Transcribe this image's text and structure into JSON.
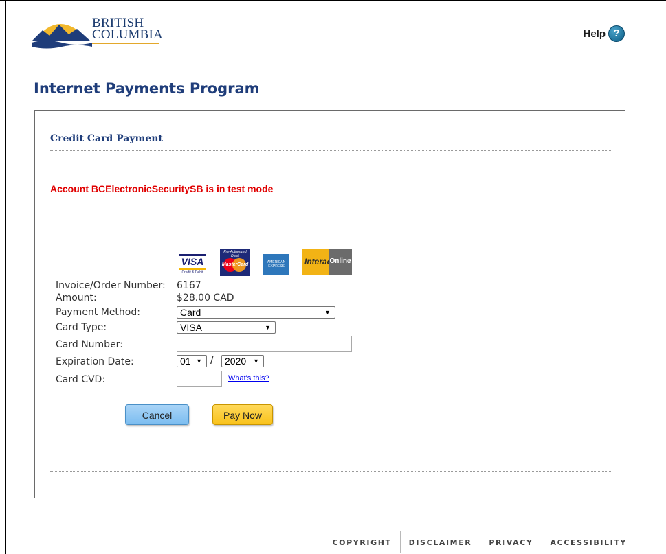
{
  "header": {
    "logo_line1": "BRITISH",
    "logo_line2": "COLUMBIA",
    "help_label": "Help",
    "help_icon_glyph": "?"
  },
  "page_title": "Internet Payments Program",
  "section_title": "Credit Card Payment",
  "test_mode_message": "Account BCElectronicSecuritySB is in test mode",
  "card_logos": {
    "visa": "VISA",
    "visa_sub": "Credit & Debit",
    "mastercard": "MasterCard",
    "mastercard_top": "Pre-Authorized Debit",
    "amex": "AMERICAN EXPRESS",
    "interac": "Interac",
    "interac_online": "Online"
  },
  "form": {
    "invoice_label": "Invoice/Order Number:",
    "invoice_value": "6167",
    "amount_label": "Amount:",
    "amount_value": "$28.00 CAD",
    "payment_method_label": "Payment Method:",
    "payment_method_value": "Card",
    "card_type_label": "Card Type:",
    "card_type_value": "VISA",
    "card_number_label": "Card Number:",
    "card_number_value": "",
    "expiration_label": "Expiration Date:",
    "exp_month_value": "01",
    "exp_separator": "/",
    "exp_year_value": "2020",
    "cvd_label": "Card CVD:",
    "cvd_value": "",
    "whats_this": "What's this?"
  },
  "buttons": {
    "cancel": "Cancel",
    "pay_now": "Pay Now"
  },
  "footer": {
    "links": [
      "COPYRIGHT",
      "DISCLAIMER",
      "PRIVACY",
      "ACCESSIBILITY"
    ]
  },
  "colors": {
    "title_blue": "#1f3d7a",
    "test_mode_red": "#e00000",
    "cancel_blue": "#7cbdf0",
    "pay_yellow": "#f9c21b"
  }
}
